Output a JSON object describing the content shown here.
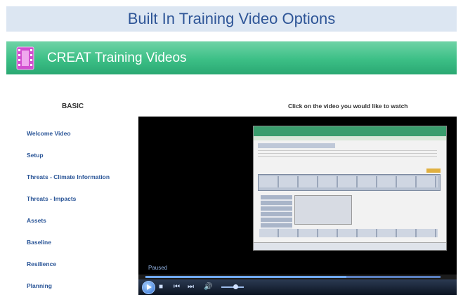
{
  "slide": {
    "title": "Built In Training Video Options"
  },
  "app": {
    "title": "CREAT Training Videos",
    "icon": "film-icon"
  },
  "sidebar": {
    "heading": "BASIC",
    "items": [
      {
        "label": "Welcome Video"
      },
      {
        "label": "Setup"
      },
      {
        "label": "Threats - Climate Information"
      },
      {
        "label": "Threats - Impacts"
      },
      {
        "label": "Assets"
      },
      {
        "label": "Baseline"
      },
      {
        "label": "Resilience"
      },
      {
        "label": "Planning"
      }
    ]
  },
  "main": {
    "instruction": "Click on the video you would like to watch"
  },
  "player": {
    "status": "Paused",
    "progress": 0.68,
    "volume": 0.62,
    "controls": [
      "play-icon",
      "stop-icon",
      "previous-icon",
      "next-icon",
      "volume-icon"
    ]
  },
  "colors": {
    "header_bg": "#dce6f2",
    "header_text": "#2e5597",
    "banner": "#3cbf86",
    "link": "#2a5597"
  }
}
